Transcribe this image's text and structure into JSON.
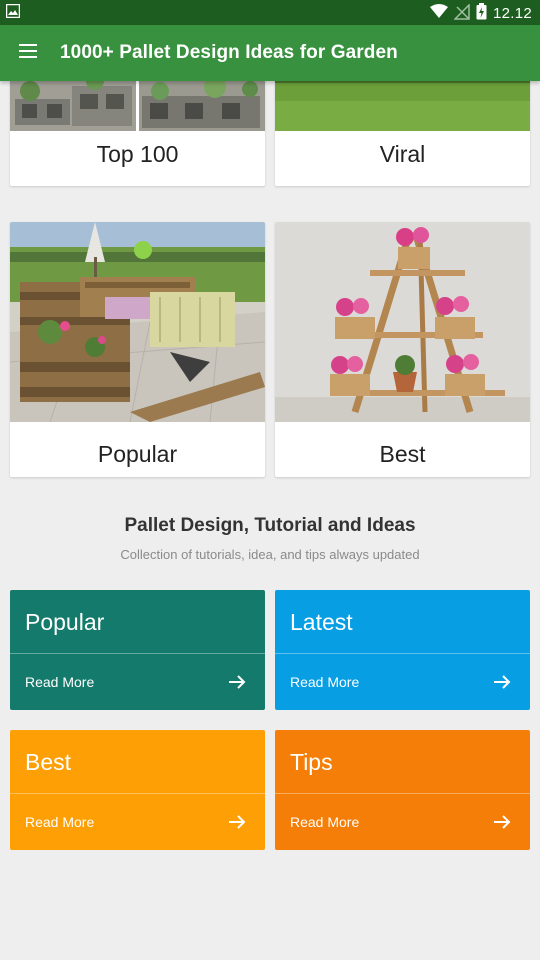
{
  "status_bar": {
    "time": "12.12"
  },
  "app_bar": {
    "title": "1000+ Pallet Design Ideas for Garden"
  },
  "category_cards": [
    {
      "label": "Top 100"
    },
    {
      "label": "Viral"
    },
    {
      "label": "Popular"
    },
    {
      "label": "Best"
    }
  ],
  "section": {
    "title": "Pallet Design, Tutorial and Ideas",
    "subtitle": "Collection of tutorials, idea, and tips always updated"
  },
  "tiles": [
    {
      "title": "Popular",
      "more": "Read More",
      "color": "#147a6b"
    },
    {
      "title": "Latest",
      "more": "Read More",
      "color": "#079ee4"
    },
    {
      "title": "Best",
      "more": "Read More",
      "color": "#fd9f05"
    },
    {
      "title": "Tips",
      "more": "Read More",
      "color": "#f47e08"
    }
  ]
}
